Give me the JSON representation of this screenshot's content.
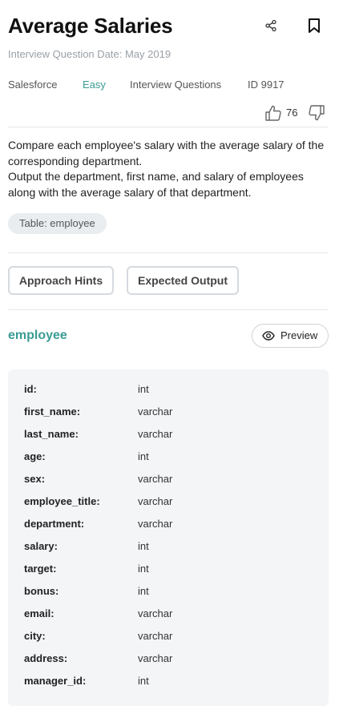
{
  "header": {
    "title": "Average Salaries",
    "date": "Interview Question Date: May 2019",
    "share_icon": "share-icon",
    "bookmark_icon": "bookmark-icon"
  },
  "meta": {
    "company": "Salesforce",
    "difficulty": "Easy",
    "category": "Interview Questions",
    "id": "ID 9917",
    "difficulty_color": "#3a9c95"
  },
  "votes": {
    "count": "76",
    "upvote_icon": "thumbs-up-icon",
    "downvote_icon": "thumbs-down-icon"
  },
  "description": {
    "line1": "Compare each employee's salary with the average salary of the corresponding department.",
    "line2": "Output the department, first name, and salary of employees along with the average salary of that department."
  },
  "table_chip": "Table: employee",
  "buttons": {
    "approach": "Approach Hints",
    "expected": "Expected Output"
  },
  "table": {
    "name": "employee",
    "preview_label": "Preview",
    "preview_icon": "eye-icon",
    "accent": "#3a9c95",
    "columns": [
      {
        "name": "id:",
        "type": "int"
      },
      {
        "name": "first_name:",
        "type": "varchar"
      },
      {
        "name": "last_name:",
        "type": "varchar"
      },
      {
        "name": "age:",
        "type": "int"
      },
      {
        "name": "sex:",
        "type": "varchar"
      },
      {
        "name": "employee_title:",
        "type": "varchar"
      },
      {
        "name": "department:",
        "type": "varchar"
      },
      {
        "name": "salary:",
        "type": "int"
      },
      {
        "name": "target:",
        "type": "int"
      },
      {
        "name": "bonus:",
        "type": "int"
      },
      {
        "name": "email:",
        "type": "varchar"
      },
      {
        "name": "city:",
        "type": "varchar"
      },
      {
        "name": "address:",
        "type": "varchar"
      },
      {
        "name": "manager_id:",
        "type": "int"
      }
    ]
  }
}
